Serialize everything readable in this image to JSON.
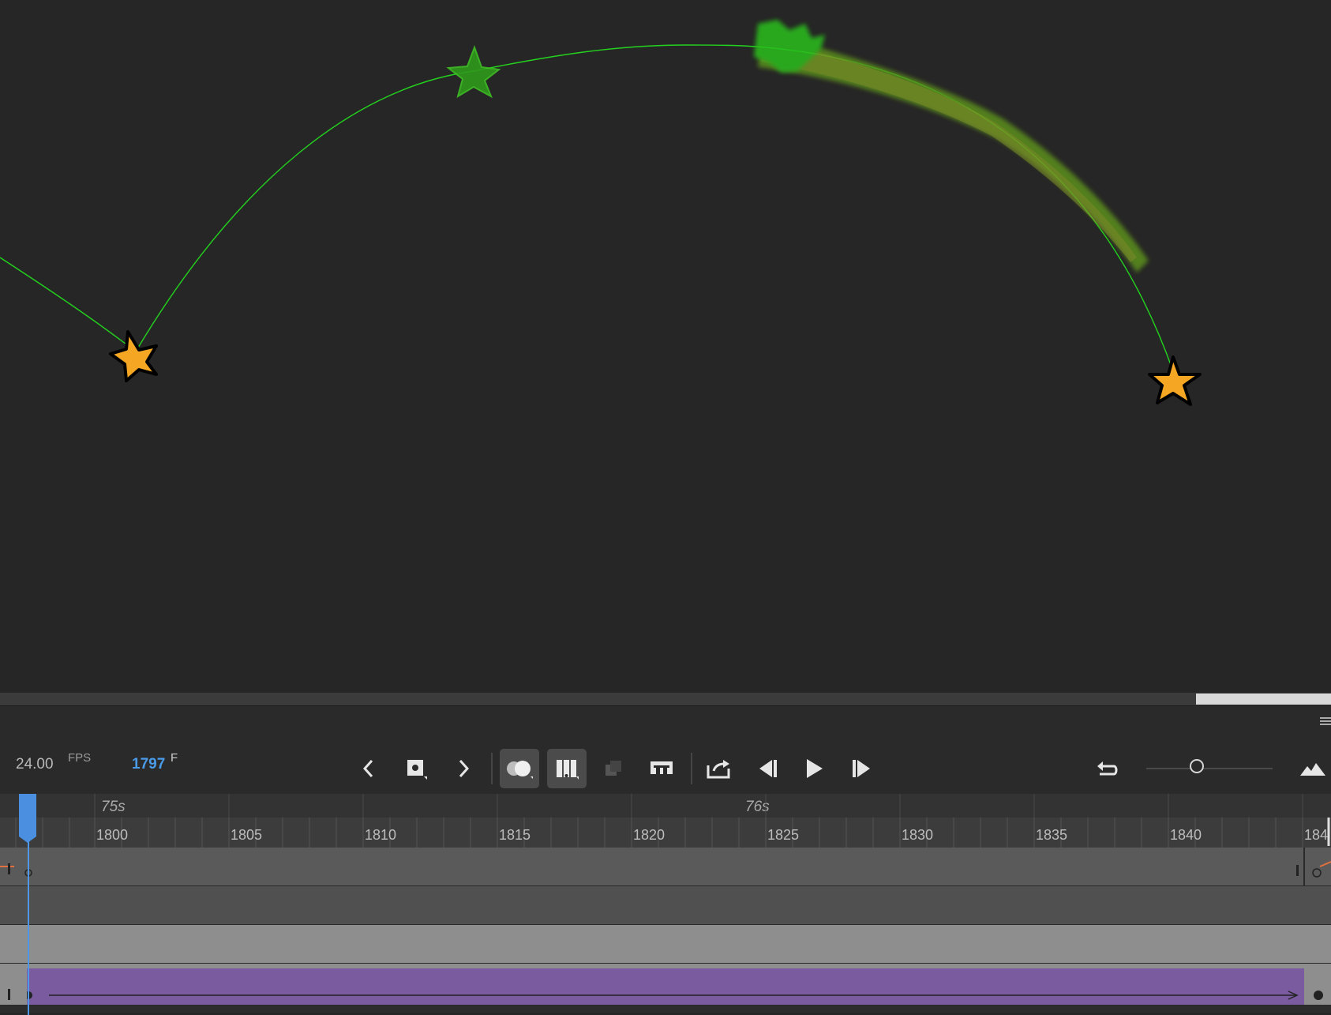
{
  "colors": {
    "stage_bg": "#262626",
    "motion_path": "#23d31e",
    "star_fill": "#f5a623",
    "accent_blue": "#4a9be8",
    "tween_purple": "#7a5ba0"
  },
  "timeline": {
    "fps_value": "24.00",
    "fps_unit": "FPS",
    "current_frame": "1797",
    "frame_unit": "F",
    "seconds_labels": [
      "75s",
      "76s"
    ],
    "frame_labels": [
      "1800",
      "1805",
      "1810",
      "1815",
      "1820",
      "1825",
      "1830",
      "1835",
      "1840",
      "184"
    ],
    "zoom_level": 0.4
  },
  "controls": {
    "icons": [
      "prev-keyframe-icon",
      "insert-keyframe-icon",
      "next-keyframe-icon",
      "onion-skin-icon",
      "onion-skin-outlines-icon",
      "edit-multiple-frames-icon",
      "loop-icon",
      "export-icon",
      "step-back-icon",
      "play-icon",
      "step-forward-icon",
      "undo-icon",
      "zoom-fit-icon"
    ]
  }
}
